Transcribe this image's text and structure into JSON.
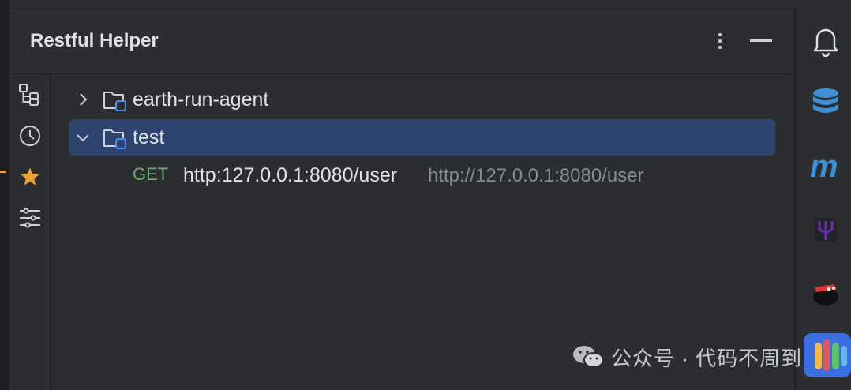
{
  "panel": {
    "title": "Restful Helper",
    "more_icon": "kebab-vertical-icon",
    "minimize_icon": "minimize-icon"
  },
  "side_toolbar": [
    {
      "name": "tree-structure-icon"
    },
    {
      "name": "history-clock-icon"
    },
    {
      "name": "favorite-star-icon",
      "color": "#e9a23b"
    },
    {
      "name": "filter-settings-icon"
    }
  ],
  "tree": {
    "nodes": [
      {
        "label": "earth-run-agent",
        "expanded": false,
        "selected": false
      },
      {
        "label": "test",
        "expanded": true,
        "selected": true
      }
    ],
    "endpoint": {
      "method": "GET",
      "path": "http:127.0.0.1:8080/user",
      "url": "http://127.0.0.1:8080/user"
    }
  },
  "right_toolbar": [
    {
      "name": "notifications-bell-icon"
    },
    {
      "name": "database-icon",
      "color": "#3d8fd6"
    },
    {
      "name": "maven-m-icon",
      "color": "#3d8fd6"
    },
    {
      "name": "trident-plugin-icon",
      "color": "#6a2fa8"
    },
    {
      "name": "ninja-plugin-icon"
    },
    {
      "name": "colorful-plugin-icon"
    }
  ],
  "watermark": {
    "text": "公众号 · 代码不周到"
  },
  "colors": {
    "background": "#2b2d30",
    "selection": "#2e436e",
    "method_get": "#6aab73",
    "muted_text": "#868a91",
    "accent": "#e9a23b"
  }
}
